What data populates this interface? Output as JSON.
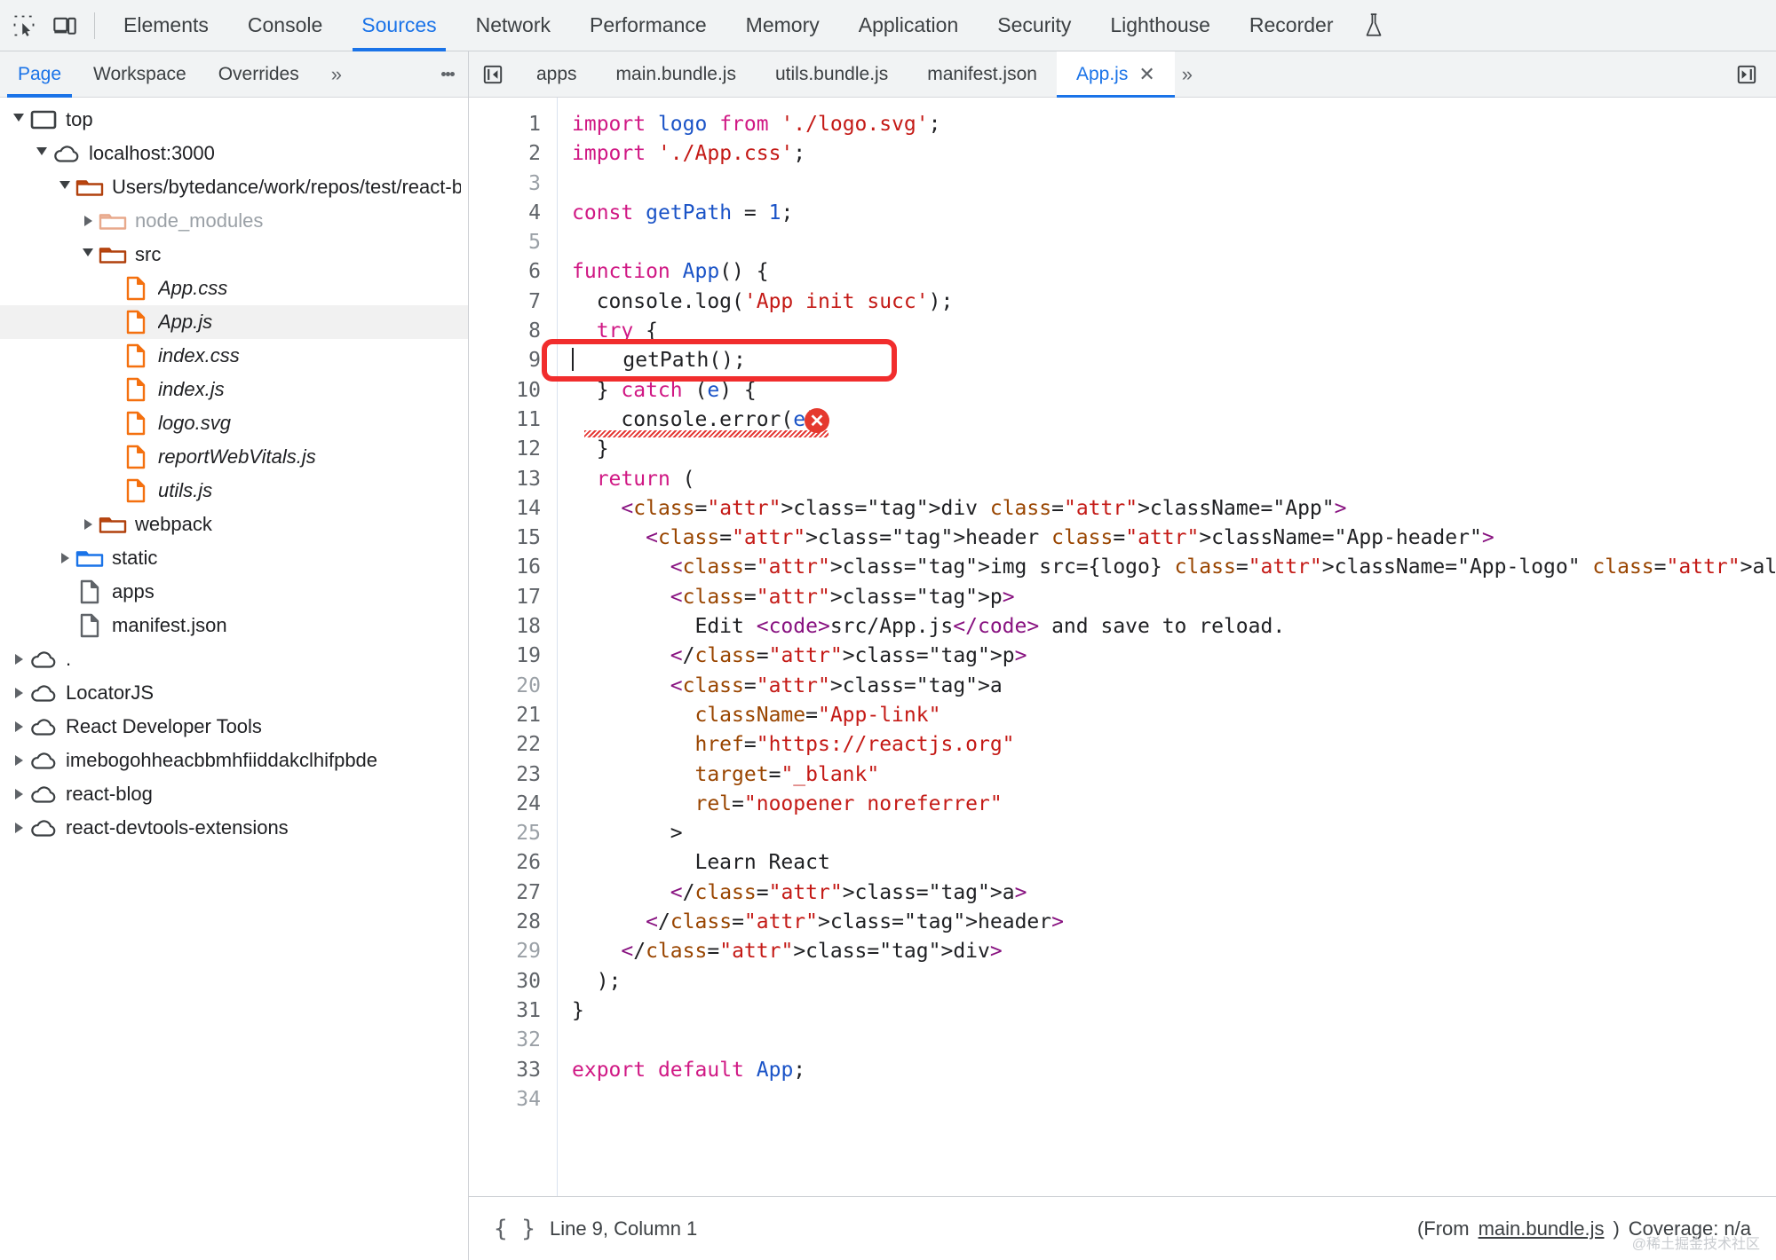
{
  "devtools": {
    "panel_tabs": [
      {
        "label": "Elements",
        "active": false
      },
      {
        "label": "Console",
        "active": false
      },
      {
        "label": "Sources",
        "active": true
      },
      {
        "label": "Network",
        "active": false
      },
      {
        "label": "Performance",
        "active": false
      },
      {
        "label": "Memory",
        "active": false
      },
      {
        "label": "Application",
        "active": false
      },
      {
        "label": "Security",
        "active": false
      },
      {
        "label": "Lighthouse",
        "active": false
      },
      {
        "label": "Recorder",
        "active": false
      }
    ],
    "inspect_icon": "inspect-element-icon",
    "device_icon": "device-toolbar-icon",
    "recorder_icon": "flask-experiment-icon",
    "dock_icon": "dock-side-icon"
  },
  "navigator": {
    "tabs": [
      {
        "label": "Page",
        "active": true
      },
      {
        "label": "Workspace",
        "active": false
      },
      {
        "label": "Overrides",
        "active": false
      }
    ],
    "more_label": "»",
    "menu_icon": "more-options-kebab-icon",
    "tree": [
      {
        "label": "top",
        "indent": 0,
        "arrow": "open",
        "icon": "frame-icon",
        "italic": false,
        "dim": false,
        "selected": false
      },
      {
        "label": "localhost:3000",
        "indent": 1,
        "arrow": "open",
        "icon": "cloud-icon",
        "italic": false,
        "dim": false,
        "selected": false
      },
      {
        "label": "Users/bytedance/work/repos/test/react-b",
        "indent": 2,
        "arrow": "open",
        "icon": "folder-orange-icon",
        "italic": false,
        "dim": false,
        "selected": false
      },
      {
        "label": "node_modules",
        "indent": 3,
        "arrow": "closed",
        "icon": "folder-faded-icon",
        "italic": false,
        "dim": true,
        "selected": false
      },
      {
        "label": "src",
        "indent": 3,
        "arrow": "open",
        "icon": "folder-orange-icon",
        "italic": false,
        "dim": false,
        "selected": false
      },
      {
        "label": "App.css",
        "indent": 4,
        "arrow": "none",
        "icon": "file-orange-icon",
        "italic": true,
        "dim": false,
        "selected": false
      },
      {
        "label": "App.js",
        "indent": 4,
        "arrow": "none",
        "icon": "file-orange-icon",
        "italic": true,
        "dim": false,
        "selected": true
      },
      {
        "label": "index.css",
        "indent": 4,
        "arrow": "none",
        "icon": "file-orange-icon",
        "italic": true,
        "dim": false,
        "selected": false
      },
      {
        "label": "index.js",
        "indent": 4,
        "arrow": "none",
        "icon": "file-orange-icon",
        "italic": true,
        "dim": false,
        "selected": false
      },
      {
        "label": "logo.svg",
        "indent": 4,
        "arrow": "none",
        "icon": "file-orange-icon",
        "italic": true,
        "dim": false,
        "selected": false
      },
      {
        "label": "reportWebVitals.js",
        "indent": 4,
        "arrow": "none",
        "icon": "file-orange-icon",
        "italic": true,
        "dim": false,
        "selected": false
      },
      {
        "label": "utils.js",
        "indent": 4,
        "arrow": "none",
        "icon": "file-orange-icon",
        "italic": true,
        "dim": false,
        "selected": false
      },
      {
        "label": "webpack",
        "indent": 3,
        "arrow": "closed",
        "icon": "folder-orange-icon",
        "italic": false,
        "dim": false,
        "selected": false
      },
      {
        "label": "static",
        "indent": 2,
        "arrow": "closed",
        "icon": "folder-blue-icon",
        "italic": false,
        "dim": false,
        "selected": false
      },
      {
        "label": "apps",
        "indent": 2,
        "arrow": "none",
        "icon": "file-gray-icon",
        "italic": false,
        "dim": false,
        "selected": false
      },
      {
        "label": "manifest.json",
        "indent": 2,
        "arrow": "none",
        "icon": "file-gray-icon",
        "italic": false,
        "dim": false,
        "selected": false
      },
      {
        "label": ".",
        "indent": 0,
        "arrow": "closed",
        "icon": "cloud-icon",
        "italic": false,
        "dim": false,
        "selected": false
      },
      {
        "label": "LocatorJS",
        "indent": 0,
        "arrow": "closed",
        "icon": "cloud-icon",
        "italic": false,
        "dim": false,
        "selected": false
      },
      {
        "label": "React Developer Tools",
        "indent": 0,
        "arrow": "closed",
        "icon": "cloud-icon",
        "italic": false,
        "dim": false,
        "selected": false
      },
      {
        "label": "imebogohheacbbmhfiiddakclhifpbde",
        "indent": 0,
        "arrow": "closed",
        "icon": "cloud-icon",
        "italic": false,
        "dim": false,
        "selected": false
      },
      {
        "label": "react-blog",
        "indent": 0,
        "arrow": "closed",
        "icon": "cloud-icon",
        "italic": false,
        "dim": false,
        "selected": false
      },
      {
        "label": "react-devtools-extensions",
        "indent": 0,
        "arrow": "closed",
        "icon": "cloud-icon",
        "italic": false,
        "dim": false,
        "selected": false
      }
    ]
  },
  "editor": {
    "back_icon": "navigate-back-icon",
    "forward_icon": "navigate-forward-icon",
    "file_tabs": [
      {
        "label": "apps",
        "active": false,
        "closable": false
      },
      {
        "label": "main.bundle.js",
        "active": false,
        "closable": false
      },
      {
        "label": "utils.bundle.js",
        "active": false,
        "closable": false
      },
      {
        "label": "manifest.json",
        "active": false,
        "closable": false
      },
      {
        "label": "App.js",
        "active": true,
        "closable": true
      }
    ],
    "close_label": "✕",
    "tabs_more_label": "»",
    "line_numbers": [
      1,
      2,
      3,
      4,
      5,
      6,
      7,
      8,
      9,
      10,
      11,
      12,
      13,
      14,
      15,
      16,
      17,
      18,
      19,
      20,
      21,
      22,
      23,
      24,
      25,
      26,
      27,
      28,
      29,
      30,
      31,
      32,
      33,
      34
    ],
    "current_line": 9,
    "highlight_note": "red annotation box around line 9",
    "error_marker": "error-x-icon",
    "code_lines": [
      "import logo from './logo.svg';",
      "import './App.css';",
      "",
      "const getPath = 1;",
      "",
      "function App() {",
      "  console.log('App init succ');",
      "  try {",
      "    getPath();",
      "  } catch (e) {",
      "    console.error(e);",
      "  }",
      "  return (",
      "    <div className=\"App\">",
      "      <header className=\"App-header\">",
      "        <img src={logo} className=\"App-logo\" alt=\"logo\" />",
      "        <p>",
      "          Edit <code>src/App.js</code> and save to reload.",
      "        </p>",
      "        <a",
      "          className=\"App-link\"",
      "          href=\"https://reactjs.org\"",
      "          target=\"_blank\"",
      "          rel=\"noopener noreferrer\"",
      "        >",
      "          Learn React",
      "        </a>",
      "      </header>",
      "    </div>",
      "  );",
      "}",
      "",
      "export default App;",
      ""
    ]
  },
  "statusbar": {
    "format_icon": "pretty-print-braces-icon",
    "position": "Line 9, Column 1",
    "from_prefix": "(From ",
    "from_file": "main.bundle.js",
    "from_suffix": ")",
    "coverage": "Coverage: n/a",
    "watermark": "@稀土掘金技术社区"
  },
  "colors": {
    "accent": "#1a73e8",
    "toolbar_bg": "#f1f3f4",
    "highlight_red": "#f12d2d",
    "error_red": "#e5392e",
    "keyword": "#d01884",
    "string": "#c41a16",
    "identifier": "#1a53c7",
    "tag": "#881280",
    "attribute": "#994500",
    "folder_orange": "#d2500f",
    "folder_blue": "#1a73e8"
  }
}
